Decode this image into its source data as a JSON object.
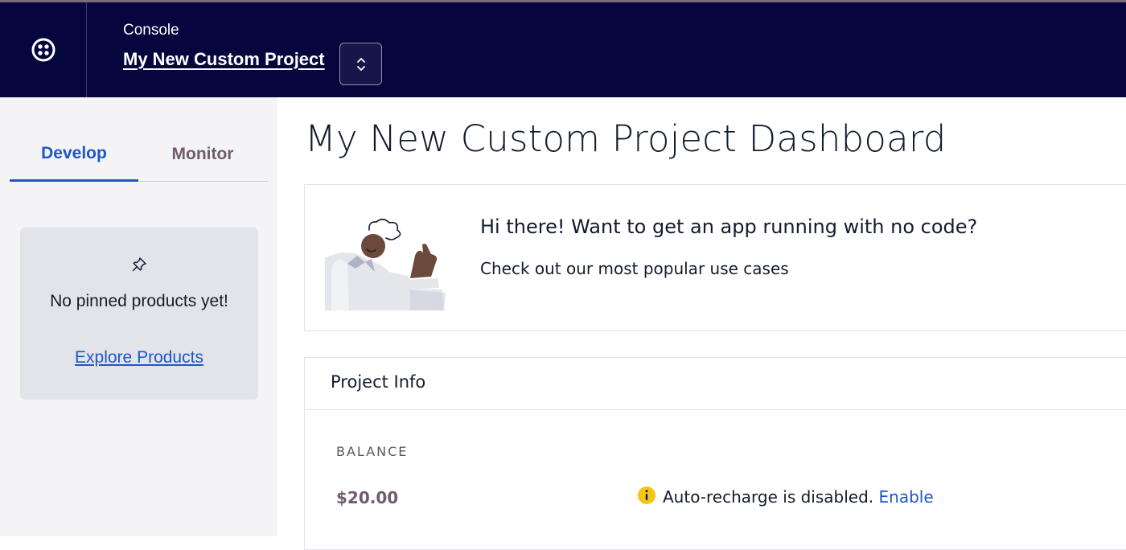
{
  "header": {
    "logo_icon": "twilio-logo-icon",
    "console_label": "Console",
    "project_name": "My New Custom Project",
    "switch_icon": "chevron-up-down-icon"
  },
  "sidebar": {
    "tabs": [
      {
        "label": "Develop",
        "active": true
      },
      {
        "label": "Monitor",
        "active": false
      }
    ],
    "pinned": {
      "icon": "pin-icon",
      "message": "No pinned products yet!",
      "link": "Explore Products"
    }
  },
  "main": {
    "title": "My New Custom Project Dashboard",
    "promo": {
      "headline": "Hi there! Want to get an app running with no code?",
      "subtext": "Check out our most popular use cases",
      "illustration": "waving-person-illustration"
    },
    "project_info": {
      "title": "Project Info",
      "balance_label": "BALANCE",
      "balance_value": "$20.00",
      "recharge_text": "Auto-recharge is disabled.",
      "enable_link": "Enable",
      "info_icon": "info-icon"
    }
  },
  "colors": {
    "header_bg": "#05063e",
    "accent": "#1f56c8",
    "warning": "#f5c518"
  }
}
